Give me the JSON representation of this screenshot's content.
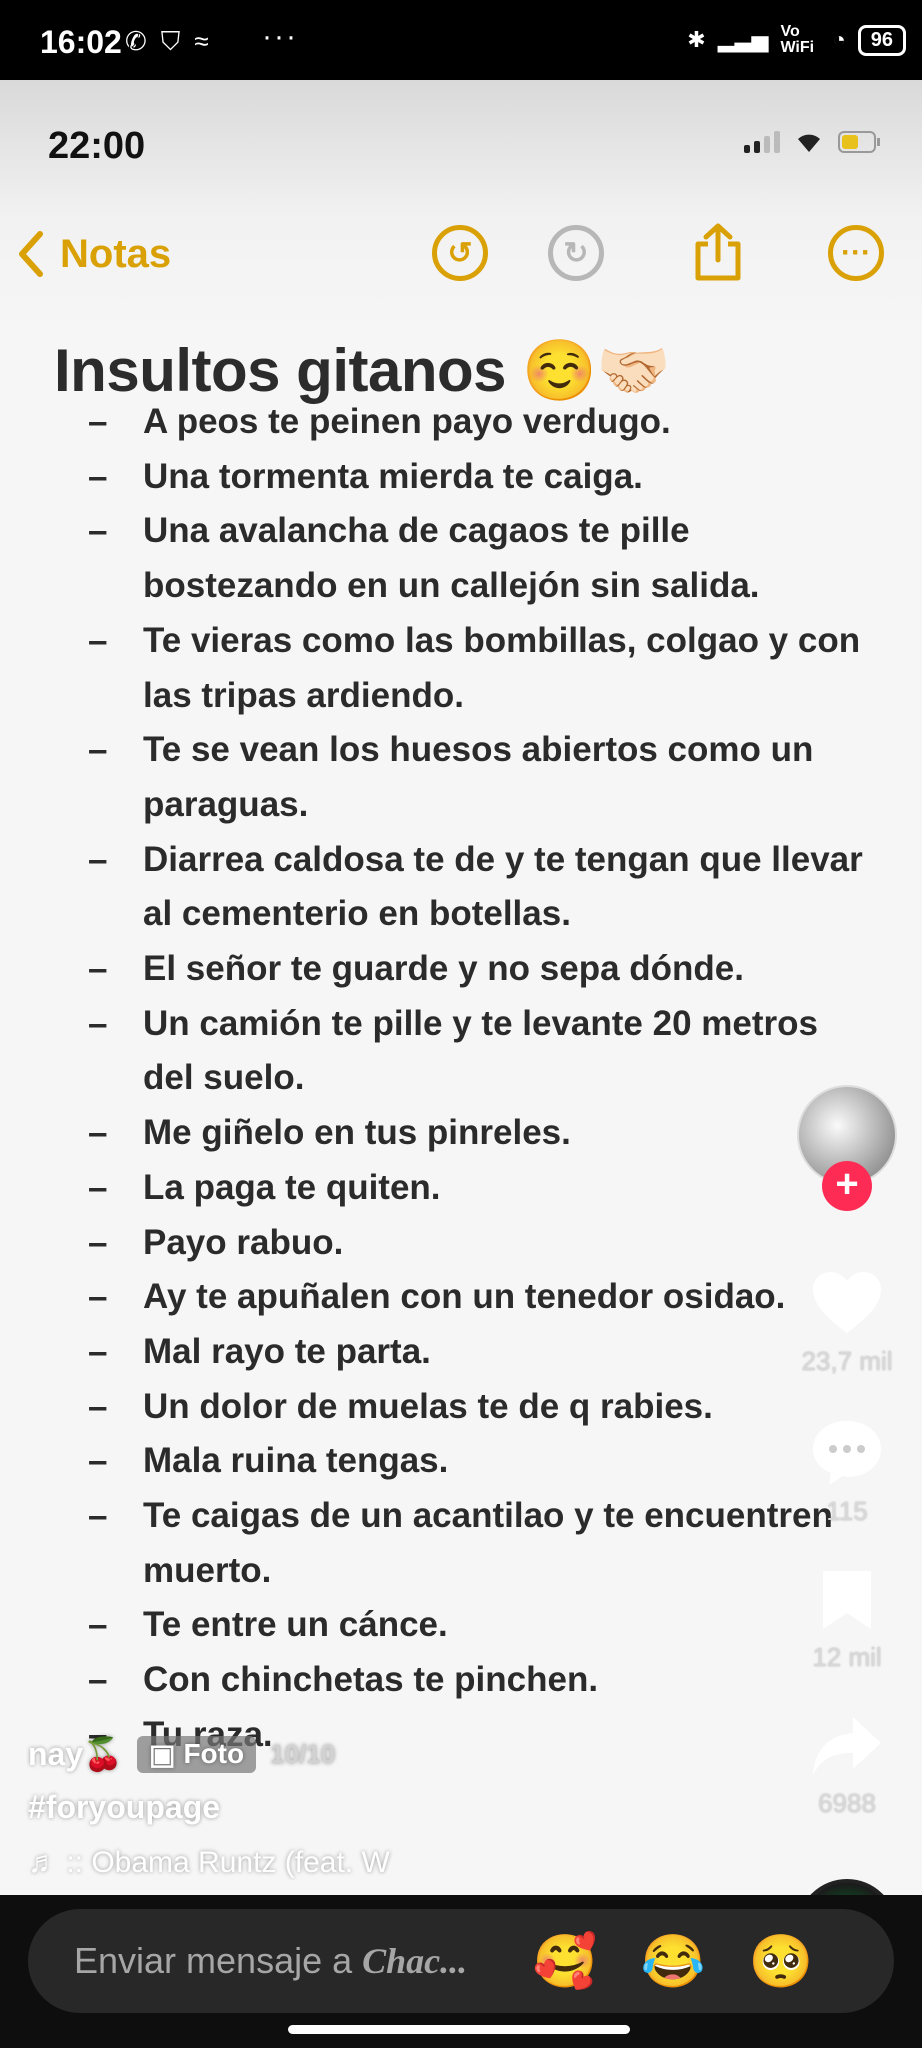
{
  "status_bar": {
    "time": "16:02",
    "network_label": "Vo WiFi",
    "battery": "96"
  },
  "inner_screen": {
    "time": "22:00",
    "back_label": "Notas",
    "note_title": "Insultos gitanos ☺️🤝🏻",
    "note_items": [
      "A peos te peinen payo verdugo.",
      "Una tormenta mierda te caiga.",
      "Una avalancha de cagaos te pille bostezando en un callejón sin salida.",
      "Te vieras como las bombillas, colgao y con las tripas ardiendo.",
      "Te se vean los huesos abiertos como un paraguas.",
      "Diarrea caldosa te de y te tengan que llevar al cementerio en botellas.",
      "El señor te guarde y no sepa dónde.",
      "Un camión te pille y te levante 20 metros del suelo.",
      "Me giñelo en tus pinreles.",
      "La paga te quiten.",
      "Payo rabuo.",
      "Ay te apuñalen con un tenedor osidao.",
      "Mal rayo te parta.",
      "Un dolor de muelas te de q rabies.",
      "Mala ruina tengas.",
      "Te caigas de un acantilao y te encuentren muerto.",
      "Te entre un cánce.",
      "Con chinchetas te pinchen.",
      "Tu raza."
    ]
  },
  "side_actions": {
    "likes": "23,7 mil",
    "comments": "115",
    "saves": "12 mil",
    "shares": "6988"
  },
  "caption": {
    "author": "nay🍒",
    "foto_label": "Foto",
    "photo_index": "10/10",
    "hashtag": "#foryoupage",
    "music": "♬ :: Obama Runtz (feat. W"
  },
  "message_bar": {
    "placeholder_prefix": "Enviar mensaje a ",
    "placeholder_name": "Chac...",
    "emoji_1": "🥰",
    "emoji_2": "😂",
    "emoji_3": "🥺"
  }
}
